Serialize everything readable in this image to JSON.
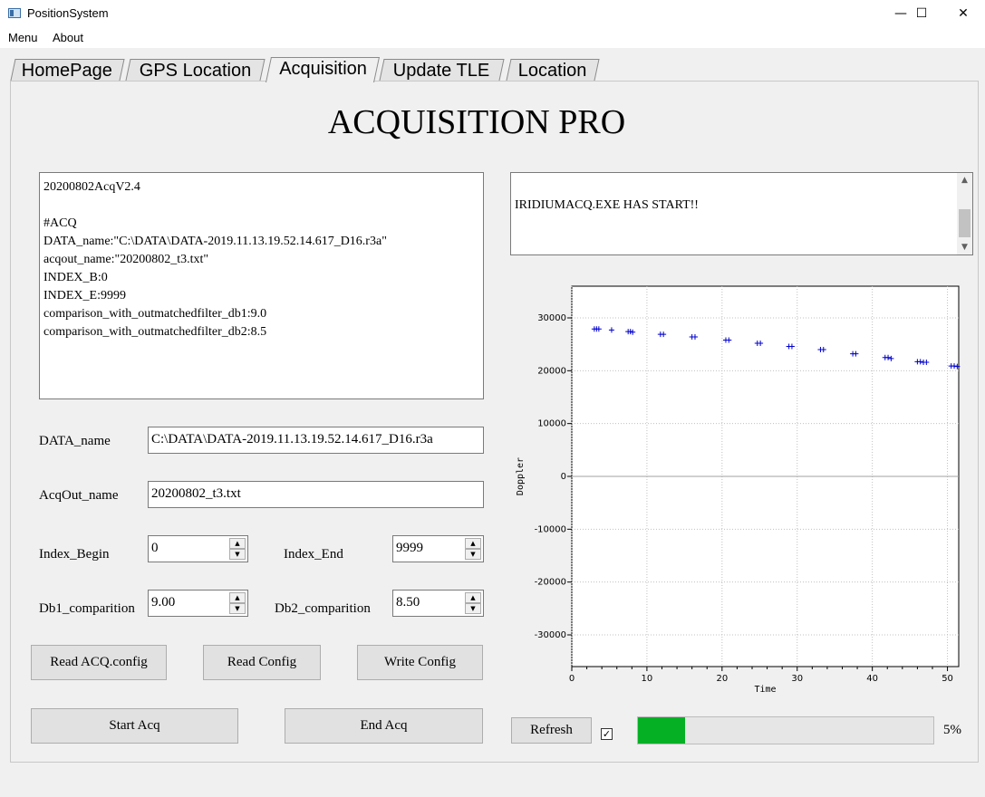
{
  "window": {
    "title": "PositionSystem",
    "controls": {
      "minimize": "—",
      "maximize": "☐",
      "close": "✕"
    }
  },
  "menu": {
    "items": [
      "Menu",
      "About"
    ]
  },
  "tabs": {
    "items": [
      "HomePage",
      "GPS Location",
      "Acquisition",
      "Update TLE",
      "Location"
    ],
    "active": "Acquisition"
  },
  "page": {
    "title": "ACQUISITION PRO"
  },
  "config_text": "20200802AcqV2.4\n\n#ACQ\nDATA_name:\"C:\\DATA\\DATA-2019.11.13.19.52.14.617_D16.r3a\"\nacqout_name:\"20200802_t3.txt\"\nINDEX_B:0\nINDEX_E:9999\ncomparison_with_outmatchedfilter_db1:9.0\ncomparison_with_outmatchedfilter_db2:8.5",
  "log_text": "IRIDIUMACQ.EXE HAS START!!",
  "form": {
    "data_name_label": "DATA_name",
    "data_name_value": "C:\\DATA\\DATA-2019.11.13.19.52.14.617_D16.r3a",
    "acqout_label": "AcqOut_name",
    "acqout_value": "20200802_t3.txt",
    "index_begin_label": "Index_Begin",
    "index_begin_value": "0",
    "index_end_label": "Index_End",
    "index_end_value": "9999",
    "db1_label": "Db1_comparition",
    "db1_value": "9.00",
    "db2_label": "Db2_comparition",
    "db2_value": "8.50"
  },
  "buttons": {
    "read_acq_config": "Read ACQ.config",
    "read_config": "Read Config",
    "write_config": "Write Config",
    "start_acq": "Start Acq",
    "end_acq": "End Acq",
    "refresh": "Refresh"
  },
  "checkbox": {
    "checked": true,
    "glyph": "✓"
  },
  "progress": {
    "percent": 5,
    "text": "5%",
    "color": "#06b025"
  },
  "chart_data": {
    "type": "scatter",
    "xlabel": "Time",
    "ylabel": "Doppler",
    "xlim": [
      0,
      51.5
    ],
    "ylim": [
      -36000,
      36000
    ],
    "xticks": [
      0,
      10,
      20,
      30,
      40,
      50
    ],
    "yticks": [
      -30000,
      -20000,
      -10000,
      0,
      10000,
      20000,
      30000
    ],
    "grid": true,
    "marker": "+",
    "color": "#0000cc",
    "series": [
      {
        "x": [
          3.0,
          3.3,
          3.6,
          5.3,
          7.5,
          7.8,
          8.1,
          11.8,
          12.2,
          16.0,
          16.4,
          20.5,
          20.9,
          24.7,
          25.1,
          28.9,
          29.3,
          33.1,
          33.5,
          37.4,
          37.8,
          41.7,
          42.1,
          42.5,
          46.0,
          46.4,
          46.8,
          47.2,
          50.5,
          50.9,
          51.3
        ],
        "y": [
          27900,
          27900,
          27900,
          27700,
          27400,
          27400,
          27300,
          26900,
          26900,
          26400,
          26400,
          25800,
          25800,
          25200,
          25200,
          24600,
          24600,
          24000,
          24000,
          23200,
          23200,
          22500,
          22500,
          22300,
          21700,
          21700,
          21600,
          21600,
          20900,
          20900,
          20800
        ]
      }
    ]
  }
}
